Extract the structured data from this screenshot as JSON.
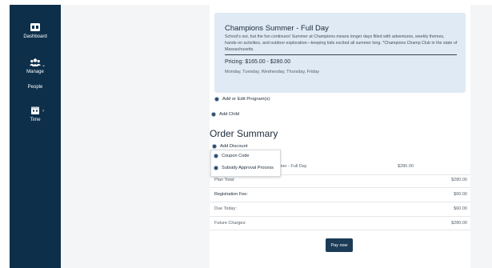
{
  "sidebar": {
    "items": [
      {
        "label": "Dashboard",
        "icon": "dashboard-icon"
      },
      {
        "label": "Manage",
        "icon": "people-group-icon"
      },
      {
        "label": "People",
        "icon": ""
      },
      {
        "label": "Time",
        "icon": "calendar-icon"
      }
    ]
  },
  "program": {
    "title": "Champions Summer - Full Day",
    "description": "School's out, but the fun continues! Summer at Champions means longer days filled with adventures, weekly themes, hands-on activities, and outdoor exploration—keeping kids excited all summer long. *Champions Champ Club in the state of Massachusetts.",
    "pricing": "Pricing: $165.00 - $280.00",
    "days": "Monday, Tuesday, Wednesday, Thursday, Friday"
  },
  "actions": {
    "add_edit_program": "Add or Edit Program(s)",
    "add_child": "Add Child"
  },
  "order_summary": {
    "title": "Order Summary",
    "add_discount": "Add Discount",
    "discount_options": [
      "Coupon Code",
      "Subsidy Approval Process"
    ],
    "line_item": {
      "name": "mer - Full Day",
      "amount": "$280.00"
    },
    "rows": [
      {
        "label": "Plan Total:",
        "value": "$280.00"
      },
      {
        "label": "Registration Fee:",
        "value": "$60.00"
      },
      {
        "label": "Due Today:",
        "value": "$60.00"
      },
      {
        "label": "Future Charges:",
        "value": "$280.00"
      }
    ],
    "pay_button": "Pay now"
  },
  "colors": {
    "sidebar": "#0d2f4a",
    "program_box": "#dfeaf4",
    "button": "#1b3b57",
    "background": "#f4f5f6"
  }
}
